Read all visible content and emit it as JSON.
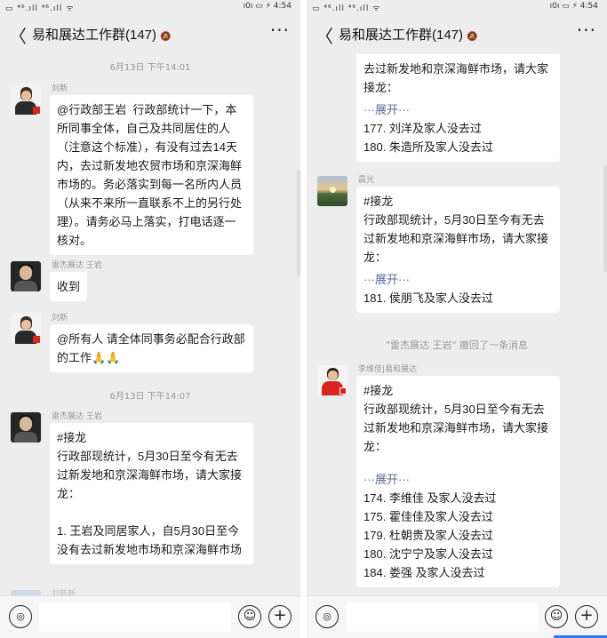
{
  "left": {
    "status": {
      "signal": "▭ ⁴⁶.ıll ⁴⁶.ıll ᯤ",
      "system": "ı0ı ▭ ⚡ 4:54"
    },
    "header": {
      "back": "〈",
      "title": "易和展达工作群(147)",
      "mute_icon": "🔕",
      "more": "···"
    },
    "timestamps": [
      "6月13日 下午14:01",
      "6月13日 下午14:07"
    ],
    "messages": [
      {
        "sender": "刘新",
        "text": "@行政部王岩  行政部统计一下，本所同事全体，自己及共同居住的人（注意这个标准），有没有过去14天内，去过新发地农贸市场和京深海鲜市场的。务必落实到每一名所内人员（从来不来所一直联系不上的另行处理）。请务必马上落实，打电话逐一核对。"
      },
      {
        "sender": "雷杰展达 王岩",
        "text": "收到"
      },
      {
        "sender": "刘新",
        "text": "@所有人 请全体同事务必配合行政部的工作🙏🙏"
      },
      {
        "sender": "雷杰展达 王岩",
        "text": "#接龙\n行政部现统计，5月30日至今有无去过新发地和京深海鲜市场，请大家接龙：\n\n1. 王岩及同居家人，自5月30日至今没有去过新发地市场和京深海鲜市场"
      },
      {
        "sender": "刘新新"
      }
    ],
    "input": {
      "voice_icon": "◎",
      "emoji_icon": "☺",
      "plus_icon": "+"
    }
  },
  "right": {
    "status": {
      "signal": "▭ ⁴⁶.ıll ⁴⁶.ıll ᯤ",
      "system": "ı0ı ▭ ⚡ 4:54"
    },
    "header": {
      "back": "〈",
      "title": "易和展达工作群(147)",
      "mute_icon": "🔕",
      "more": "···"
    },
    "messages": [
      {
        "text_top": "去过新发地和京深海鲜市场，请大家接龙：",
        "expand": "···展开···",
        "items": [
          "177. 刘洋及家人没去过",
          "180. 朱造所及家人没去过"
        ]
      },
      {
        "sender": "晨光",
        "text": "#接龙\n行政部现统计，5月30日至今有无去过新发地和京深海鲜市场，请大家接龙：",
        "expand": "···展开···",
        "items": [
          "181. 侯朋飞及家人没去过"
        ]
      },
      {
        "sender": "李维佳|易和展达",
        "text": "#接龙\n行政部现统计，5月30日至今有无去过新发地和京深海鲜市场，请大家接龙：",
        "expand": "···展开···",
        "items": [
          "174. 李维佳 及家人没去过",
          "175. 霍佳佳及家人没去过",
          "179. 杜朝贵及家人没去过",
          "180. 沈宁宁及家人没去过",
          "184. 娄强 及家人没去过"
        ]
      }
    ],
    "system_msg": "\"雷杰展达 王岩\" 撤回了一条消息",
    "input": {
      "voice_icon": "◎",
      "emoji_icon": "☺",
      "plus_icon": "+"
    }
  }
}
